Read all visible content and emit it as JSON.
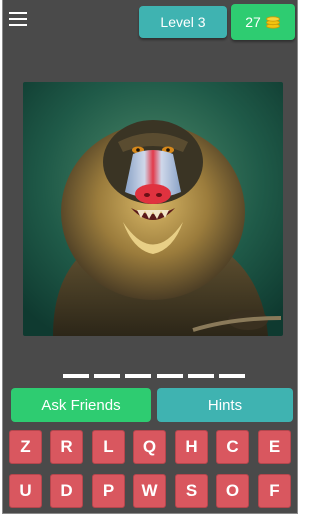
{
  "header": {
    "level_label": "Level 3",
    "coins": "27"
  },
  "answer": {
    "slot_count": 6
  },
  "actions": {
    "ask_friends_label": "Ask Friends",
    "hints_label": "Hints"
  },
  "keyboard": {
    "row1": [
      "Z",
      "R",
      "L",
      "Q",
      "H",
      "C",
      "E"
    ],
    "row2": [
      "U",
      "D",
      "P",
      "W",
      "S",
      "O",
      "F"
    ]
  },
  "colors": {
    "background": "#4a4a4a",
    "teal": "#3fb3b1",
    "green": "#2ecc71",
    "key_red": "#d9575f"
  },
  "icons": {
    "menu": "hamburger-menu-icon",
    "coins": "coin-stack-icon"
  }
}
